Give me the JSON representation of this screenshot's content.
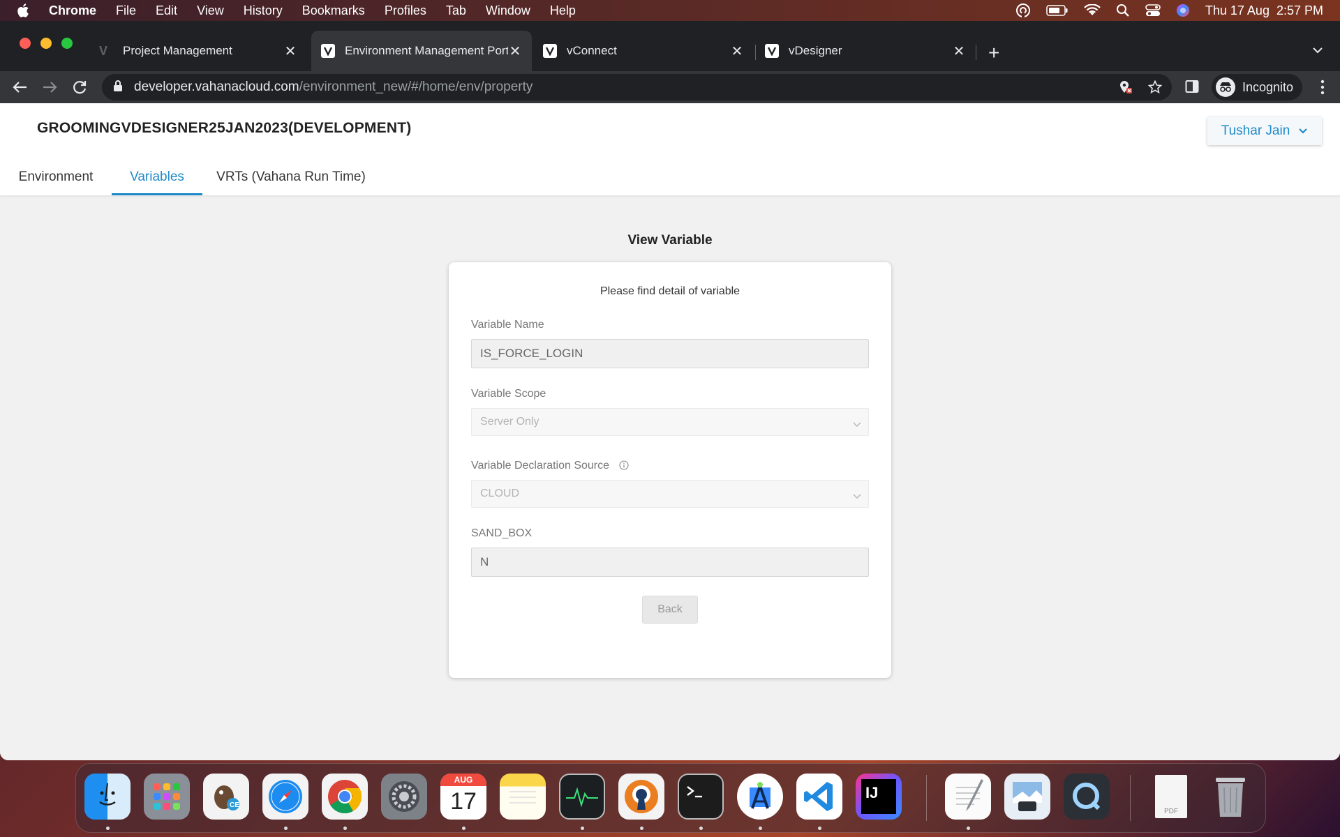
{
  "menubar": {
    "app": "Chrome",
    "items": [
      "File",
      "Edit",
      "View",
      "History",
      "Bookmarks",
      "Profiles",
      "Tab",
      "Window",
      "Help"
    ],
    "clock": "Thu 17 Aug  2:57 PM"
  },
  "browser": {
    "tabs": [
      {
        "title": "Project Management"
      },
      {
        "title": "Environment Management Port"
      },
      {
        "title": "vConnect"
      },
      {
        "title": "vDesigner"
      }
    ],
    "url_host": "developer.vahanacloud.com",
    "url_path": "/environment_new/#/home/env/property",
    "profile_label": "Incognito"
  },
  "app": {
    "environment_title": "GROOMINGVDESIGNER25JAN2023(DEVELOPMENT)",
    "user_name": "Tushar Jain",
    "nav_tabs": [
      {
        "label": "Environment"
      },
      {
        "label": "Variables"
      },
      {
        "label": "VRTs (Vahana Run Time)"
      }
    ],
    "active_tab": "Variables"
  },
  "form": {
    "heading": "View Variable",
    "intro": "Please find detail of variable",
    "variable_name_label": "Variable Name",
    "variable_name_value": "IS_FORCE_LOGIN",
    "scope_label": "Variable Scope",
    "scope_value": "Server Only",
    "source_label": "Variable Declaration Source",
    "source_value": "CLOUD",
    "sandbox_label": "SAND_BOX",
    "sandbox_value": "N",
    "back_label": "Back"
  },
  "dock": {
    "calendar_month": "AUG",
    "calendar_day": "17",
    "intellij_label": "IJ",
    "pdf_label": "PDF"
  },
  "colors": {
    "accent": "#1f8ac9",
    "page_bg": "#f1f1f1"
  }
}
